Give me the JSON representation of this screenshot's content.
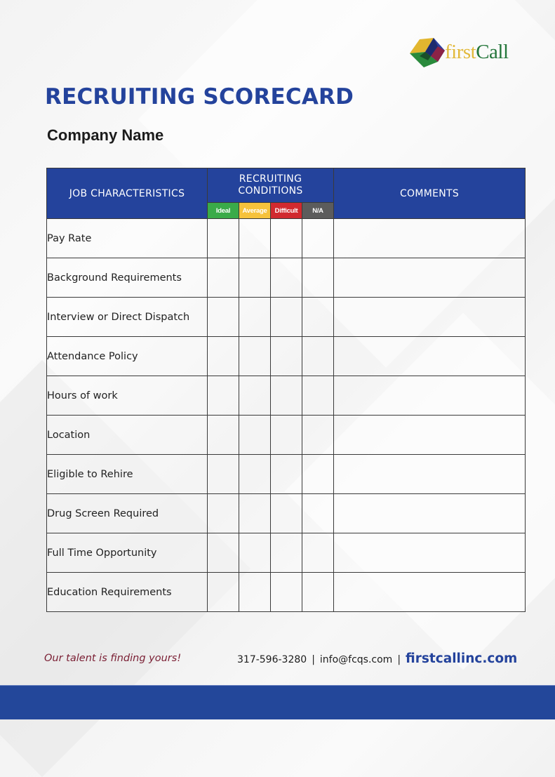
{
  "brand": {
    "logo_first": "first",
    "logo_call": "Call",
    "logo_icon": "cube-logo-icon"
  },
  "title": "RECRUITING SCORECARD",
  "company_label": "Company Name",
  "table": {
    "headers": {
      "characteristics": "JOB CHARACTERISTICS",
      "conditions": "RECRUITING CONDITIONS",
      "comments": "COMMENTS"
    },
    "condition_levels": [
      {
        "label": "Ideal",
        "color": "#3aab49"
      },
      {
        "label": "Average",
        "color": "#f6c23b"
      },
      {
        "label": "Difficult",
        "color": "#d12a2f"
      },
      {
        "label": "N/A",
        "color": "#5c5c5c"
      }
    ],
    "rows": [
      {
        "characteristic": "Pay Rate"
      },
      {
        "characteristic": "Background Requirements"
      },
      {
        "characteristic": "Interview or Direct Dispatch"
      },
      {
        "characteristic": "Attendance Policy"
      },
      {
        "characteristic": "Hours of work"
      },
      {
        "characteristic": "Location"
      },
      {
        "characteristic": "Eligible to Rehire"
      },
      {
        "characteristic": "Drug Screen Required"
      },
      {
        "characteristic": "Full Time Opportunity"
      },
      {
        "characteristic": "Education Requirements"
      }
    ]
  },
  "footer": {
    "tagline": "Our talent is finding yours!",
    "phone": "317-596-3280",
    "separator": "|",
    "email": "info@fcqs.com",
    "website": "firstcallinc.com"
  },
  "colors": {
    "brand_blue": "#24439c",
    "tagline_maroon": "#7a1e33",
    "logo_gold": "#e2b93b",
    "logo_green": "#23763a"
  }
}
